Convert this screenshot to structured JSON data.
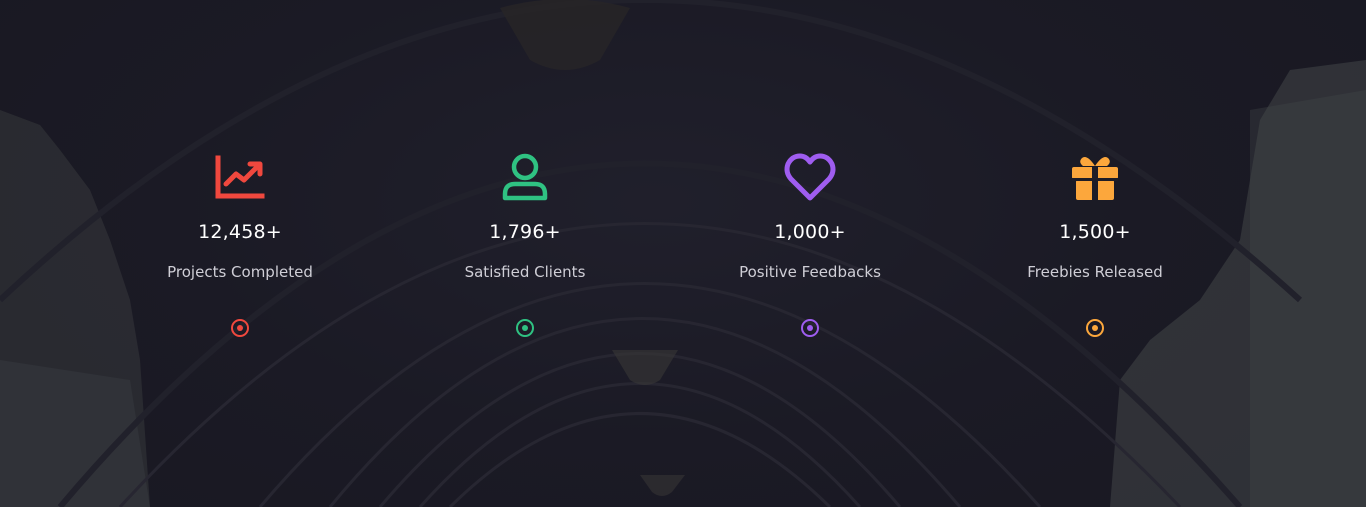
{
  "stats": [
    {
      "value": "12,458+",
      "label": "Projects Completed",
      "icon": "chart-trending-up-icon",
      "color": "#f0483e"
    },
    {
      "value": "1,796+",
      "label": "Satisfied Clients",
      "icon": "user-icon",
      "color": "#2fc282"
    },
    {
      "value": "1,000+",
      "label": "Positive Feedbacks",
      "icon": "heart-icon",
      "color": "#9f5df0"
    },
    {
      "value": "1,500+",
      "label": "Freebies Released",
      "icon": "gift-icon",
      "color": "#fca73c"
    }
  ]
}
